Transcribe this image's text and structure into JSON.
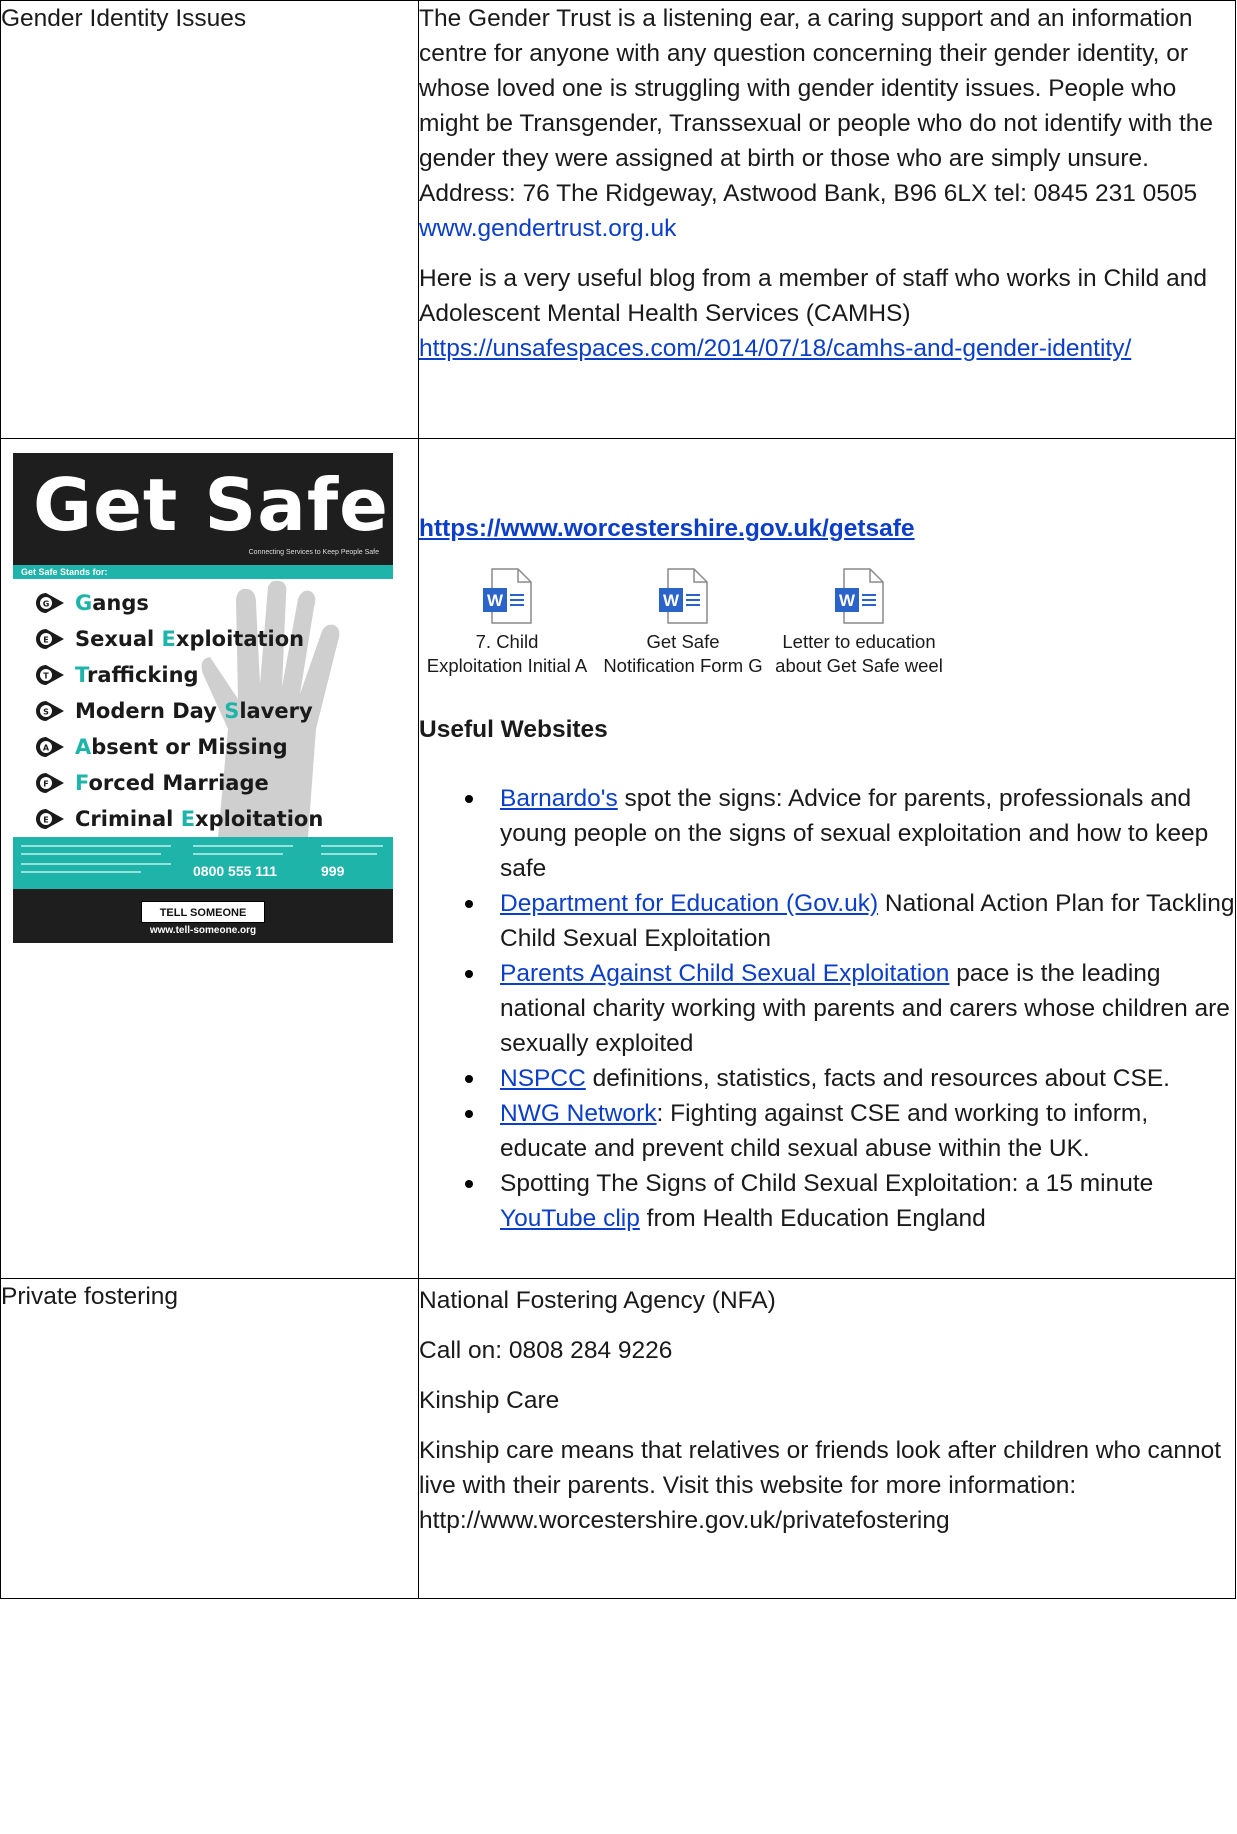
{
  "row1": {
    "topic": "Gender Identity Issues",
    "para1": "The Gender Trust is a listening ear, a caring support and an information centre for anyone with any question concerning their gender identity, or whose loved one is struggling with gender identity issues. People who might be Transgender, Transsexual or people who do not identify with the gender they were assigned at birth or those who are simply unsure. Address: 76 The Ridgeway, Astwood Bank, B96 6LX tel: 0845 231 0505",
    "link1": "www.gendertrust.org.uk",
    "para2": "Here is a very useful blog from a member of staff who works in Child and Adolescent Mental Health Services (CAMHS)",
    "link2": "https://unsafespaces.com/2014/07/18/camhs-and-gender-identity/"
  },
  "row2": {
    "poster": {
      "title": "Get Safe",
      "subtitle": "Connecting Services to Keep People Safe",
      "stands_for": "Get Safe Stands for:",
      "items": [
        {
          "letter": "G",
          "pre": "",
          "acc": "G",
          "post": "angs"
        },
        {
          "letter": "E",
          "pre": "Sexual ",
          "acc": "E",
          "post": "xploitation"
        },
        {
          "letter": "T",
          "pre": "",
          "acc": "T",
          "post": "rafficking"
        },
        {
          "letter": "S",
          "pre": "Modern Day ",
          "acc": "S",
          "post": "lavery"
        },
        {
          "letter": "A",
          "pre": "",
          "acc": "A",
          "post": "bsent or Missing"
        },
        {
          "letter": "F",
          "pre": "",
          "acc": "F",
          "post": "orced Marriage"
        },
        {
          "letter": "E",
          "pre": "Criminal ",
          "acc": "E",
          "post": "xploitation"
        }
      ],
      "phone1": "0800 555 111",
      "phone2": "999",
      "badge": "TELL SOMEONE",
      "url": "www.tell-someone.org"
    },
    "main_link": "https://www.worcestershire.gov.uk/getsafe",
    "attachments": [
      {
        "line1": "7. Child",
        "line2": "Exploitation Initial A",
        "icon": "word-doc-icon"
      },
      {
        "line1": "Get Safe",
        "line2": "Notification Form G",
        "icon": "word-doc-icon"
      },
      {
        "line1": "Letter to education",
        "line2": "about Get Safe weel",
        "icon": "word-doc-icon"
      }
    ],
    "useful_heading": "Useful Websites",
    "bullets": [
      {
        "link": "Barnardo's",
        "text": " spot the signs: Advice for parents, professionals and young people on the signs of sexual exploitation and how to keep safe"
      },
      {
        "link": "Department for Education (Gov.uk)",
        "text": " National Action Plan for Tackling Child Sexual Exploitation"
      },
      {
        "link": "Parents Against Child Sexual Exploitation",
        "text": " pace is the leading national charity working with parents and carers whose children are sexually exploited"
      },
      {
        "link": "NSPCC",
        "text": " definitions, statistics, facts and resources about CSE."
      },
      {
        "link": "NWG Network",
        "text": ": Fighting against CSE and working to inform, educate and prevent child sexual abuse within the UK."
      }
    ],
    "last_bullet": {
      "pre": "Spotting The Signs of Child Sexual Exploitation: a 15 minute ",
      "link": "YouTube clip",
      "post": " from Health Education England"
    }
  },
  "row3": {
    "topic": "Private fostering",
    "agency": "National Fostering Agency (NFA)",
    "call": "Call on: 0808 284 9226",
    "kinship_title": "Kinship Care",
    "kinship_text": "Kinship care means that relatives or friends look after children who cannot live with their parents. Visit this website for more information: http://www.worcestershire.gov.uk/privatefostering"
  },
  "colors": {
    "link": "#0b3ec9",
    "teal": "#1fb4aa",
    "poster_dark": "#1e1e1e"
  }
}
